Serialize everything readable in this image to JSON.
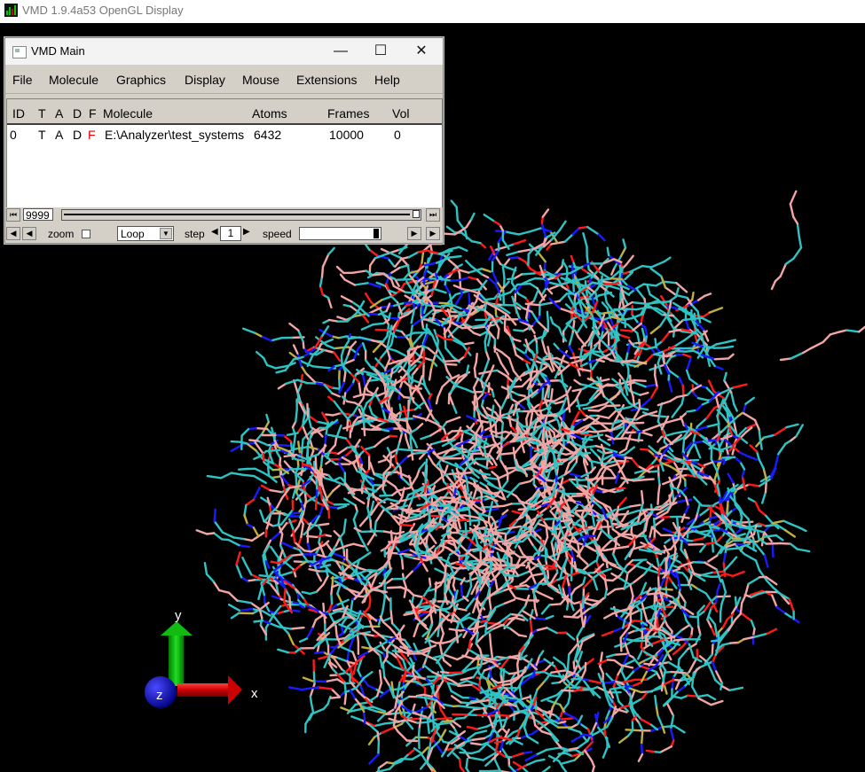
{
  "gl_window": {
    "title": "VMD 1.9.4a53 OpenGL Display",
    "icon": "vmd-app-icon"
  },
  "main_window": {
    "title": "VMD Main",
    "controls": {
      "minimize": "—",
      "maximize": "☐",
      "close": "✕"
    },
    "menu": [
      "File",
      "Molecule",
      "Graphics",
      "Display",
      "Mouse",
      "Extensions",
      "Help"
    ],
    "columns": [
      "ID",
      "T",
      "A",
      "D",
      "F",
      "Molecule",
      "Atoms",
      "Frames",
      "Vol"
    ],
    "rows": [
      {
        "id": "0",
        "t": "T",
        "a": "A",
        "d": "D",
        "f": "F",
        "molecule": "E:\\Analyzer\\test_systems",
        "atoms": "6432",
        "frames": "10000",
        "vol": "0"
      }
    ],
    "frame_value": "9999",
    "zoom_label": "zoom",
    "zoom_checked": false,
    "loop_mode": "Loop",
    "step_label": "step",
    "step_value": "1",
    "speed_label": "speed"
  },
  "axes": {
    "x": "x",
    "y": "y",
    "z": "z"
  },
  "colors": {
    "carbon": "#2fc3c3",
    "hydrogen": "#f2a5a5",
    "nitrogen": "#1a1aff",
    "oxygen": "#ff1a1a",
    "sulfur": "#c0b040",
    "x_axis": "#e00000",
    "y_axis": "#00c000",
    "z_axis": "#1010d0"
  }
}
